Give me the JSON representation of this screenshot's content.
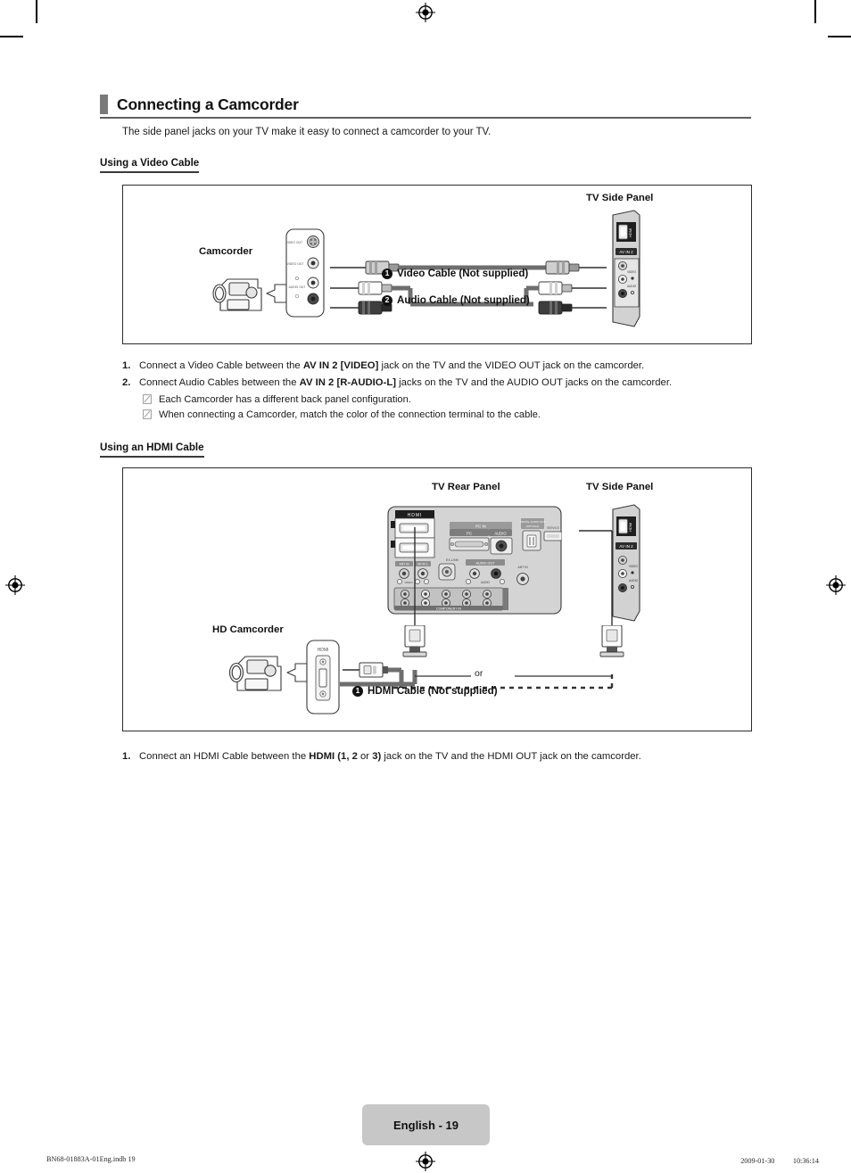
{
  "document": {
    "heading": "Connecting a Camcorder",
    "intro": "The side panel jacks on your TV make it easy to connect a camcorder to your TV.",
    "page_tag": "English - 19",
    "footer_left": "BN68-01883A-01Eng.indb   19",
    "footer_right": "2009-01-30   　　 10:36:14"
  },
  "section_video": {
    "subheading": "Using a Video Cable",
    "diagram": {
      "camcorder_label": "Camcorder",
      "tv_side_panel_label": "TV Side Panel",
      "camcorder_jacks": [
        "S-VIDEO OUT",
        "VIDEO OUT",
        "AUDIO OUT"
      ],
      "tv_side_jacks": [
        "HDMI",
        "AV IN 2",
        "VIDEO",
        "AUDIO"
      ],
      "cable_1_num": "1",
      "cable_1_label": "Video Cable (Not supplied)",
      "cable_2_num": "2",
      "cable_2_label": "Audio Cable (Not supplied)"
    },
    "steps": [
      {
        "num": "1.",
        "pre": "Connect a Video Cable between the ",
        "bold": "AV IN 2 [VIDEO]",
        "post": " jack on the TV and the VIDEO OUT jack on the camcorder."
      },
      {
        "num": "2.",
        "pre": "Connect Audio Cables between the ",
        "bold": "AV IN 2 [R-AUDIO-L]",
        "post": " jacks on the TV and the AUDIO OUT jacks on the camcorder."
      }
    ],
    "notes": [
      "Each Camcorder has a different back panel configuration.",
      "When connecting a Camcorder, match the color of the connection terminal to the cable."
    ]
  },
  "section_hdmi": {
    "subheading": "Using an HDMI Cable",
    "diagram": {
      "tv_rear_panel_label": "TV Rear Panel",
      "tv_side_panel_label": "TV Side Panel",
      "hd_camcorder_label": "HD Camcorder",
      "camcorder_jack_label": "HDMI",
      "or_label": "or",
      "cable_1_num": "1",
      "cable_1_label": "HDMI Cable (Not supplied)",
      "rear_panel_jacks": [
        "HDMI",
        "PC IN",
        "PC",
        "AUDIO",
        "DIGITAL AUDIO OUT",
        "OPTICAL",
        "SERVICE",
        "EX-LINK",
        "AUDIO OUT",
        "AUDIO",
        "COMPONENT IN",
        "ANT IN",
        "AV IN 1"
      ],
      "side_panel_jacks": [
        "HDMI",
        "AV IN 2",
        "VIDEO",
        "AUDIO"
      ]
    },
    "steps": [
      {
        "num": "1.",
        "pre": "Connect an HDMI Cable between the ",
        "bold": "HDMI (1, 2",
        "mid": " or ",
        "bold2": "3)",
        "post": " jack on the TV and the HDMI OUT jack on the camcorder."
      }
    ]
  },
  "colors": {
    "accent_bar": "#7a7a7a",
    "rule": "#5f5f5f",
    "page_tag_bg": "#c7c7c7",
    "panel_gray": "#d2d2d2",
    "cable_gray": "#6e6e6e",
    "border": "#2c2c2c"
  }
}
